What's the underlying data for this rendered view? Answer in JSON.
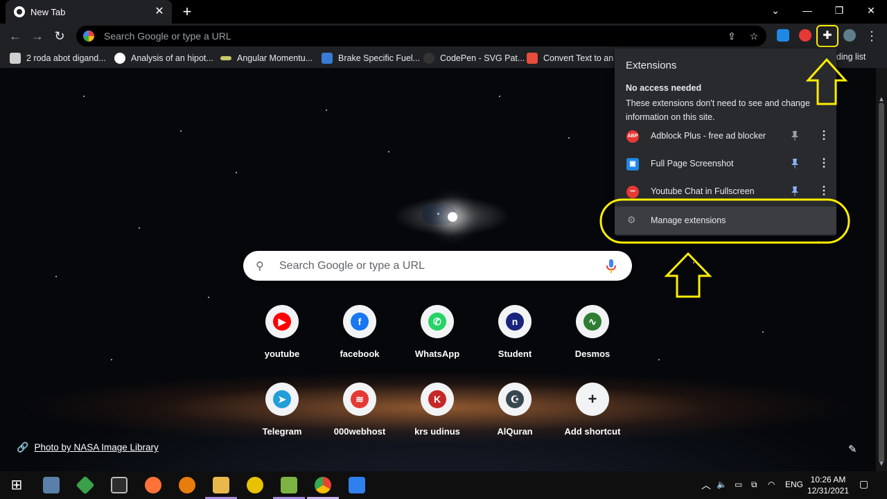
{
  "window": {
    "tab_title": "New Tab",
    "tab_close": "✕",
    "new_tab": "+",
    "controls": {
      "chevron": "⌄",
      "minimize": "—",
      "restore": "❐",
      "close": "✕"
    }
  },
  "toolbar": {
    "back": "←",
    "forward": "→",
    "reload": "↻",
    "omnibox_placeholder": "Search Google or type a URL",
    "share_icon": "⇪",
    "star_icon": "☆",
    "puzzle_icon": "✚",
    "menu_icon": "⋮"
  },
  "bookmarks": [
    {
      "label": "2 roda abot digand...",
      "color": "#cfcfcf"
    },
    {
      "label": "Analysis of an hipot...",
      "color": "#ffffff"
    },
    {
      "label": "Angular Momentu...",
      "color": "#c8c86a"
    },
    {
      "label": "Brake Specific Fuel...",
      "color": "#3a7bd5"
    },
    {
      "label": "CodePen - SVG Pat...",
      "color": "#333333"
    },
    {
      "label": "Convert Text to an I",
      "color": "#e74c3c"
    }
  ],
  "reading_list": "Reading list",
  "search": {
    "placeholder": "Search Google or type a URL",
    "search_icon": "⚲"
  },
  "shortcuts": [
    {
      "label": "youtube",
      "glyph": "▶",
      "bg": "#ff0000"
    },
    {
      "label": "facebook",
      "glyph": "f",
      "bg": "#1877f2"
    },
    {
      "label": "WhatsApp",
      "glyph": "✆",
      "bg": "#25d366"
    },
    {
      "label": "Student",
      "glyph": "n",
      "bg": "#1a237e"
    },
    {
      "label": "Desmos",
      "glyph": "∿",
      "bg": "#2e7d32"
    },
    {
      "label": "Telegram",
      "glyph": "➤",
      "bg": "#229ed9"
    },
    {
      "label": "000webhost",
      "glyph": "≋",
      "bg": "#e53935"
    },
    {
      "label": "krs udinus",
      "glyph": "K",
      "bg": "#c62828"
    },
    {
      "label": "AlQuran",
      "glyph": "☪",
      "bg": "#37474f"
    },
    {
      "label": "Add shortcut",
      "glyph": "+",
      "bg": "#f1f3f4"
    }
  ],
  "photo_credit": {
    "icon": "🔗",
    "text": "Photo by NASA Image Library"
  },
  "edit_icon": "✎",
  "extensions_popup": {
    "title": "Extensions",
    "section_heading": "No access needed",
    "section_desc": "These extensions don't need to see and change information on this site.",
    "items": [
      {
        "name": "Adblock Plus - free ad blocker",
        "badge": "ABP",
        "color": "#e53935",
        "pinned": false
      },
      {
        "name": "Full Page Screenshot",
        "badge": "▣",
        "color": "#1e88e5",
        "pinned": true
      },
      {
        "name": "Youtube Chat in Fullscreen",
        "badge": "•••",
        "color": "#e53935",
        "pinned": true
      }
    ],
    "pin_icon": "📌",
    "more_icon": "⋮",
    "manage_label": "Manage extensions",
    "gear_icon": "⚙"
  },
  "colors": {
    "accent_yellow": "#ffef00",
    "pin_active": "#8ab4f8",
    "pin_inactive": "#9aa0a6"
  },
  "taskbar": {
    "start_icon": "⊞",
    "tray_chevron": "︿",
    "language": "ENG",
    "time": "10:26 AM",
    "date": "12/31/2021"
  }
}
